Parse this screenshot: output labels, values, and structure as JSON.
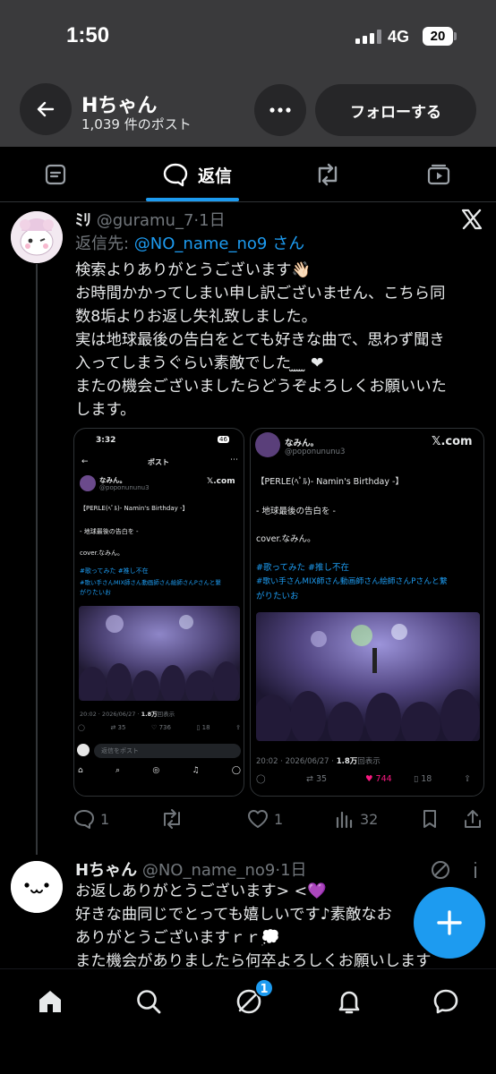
{
  "status_bar": {
    "time": "1:50",
    "network": "4G",
    "battery": "20"
  },
  "header": {
    "name": "Hちゃん",
    "post_count": "1,039 件のポスト",
    "follow_label": "フォローする"
  },
  "tabs": {
    "replies_label": "返信"
  },
  "post1": {
    "display_name": "ﾐﾘ",
    "handle": "@guramu_7",
    "time": "·1日",
    "reply_prefix": "返信先: ",
    "reply_handle": "@NO_name_no9",
    "reply_suffix": " さん",
    "lines": [
      "検索よりありがとうございます👋🏻",
      "お時間かかってしまい申し訳ございません、こちら同",
      "数8垢よりお返し失礼致しました。",
      "実は地球最後の告白をとても好きな曲で、思わず聞き",
      "入ってしまうぐらい素敵でした ̫ ̫ ̫ ❤",
      "またの機会ございましたらどうぞよろしくお願いいた",
      "します。"
    ],
    "stats": {
      "replies": "1",
      "likes": "1",
      "views": "32"
    }
  },
  "media1": {
    "time": "3:32",
    "battery": "46",
    "page_title": "ポスト",
    "author_name": "なみん。",
    "author_handle": "@poponununu3",
    "x_label": "𝕏.com",
    "line1": "【PERLE(ﾍﾟﾙ)- Namin's Birthday -】",
    "line2": "- 地球最後の告白を -",
    "line3": "cover.なみん。",
    "tags1": "#歌ってみた #推し不在",
    "tags2": "#歌い手さんMIX師さん動画師さん絵師さんPさんと繋",
    "tags3": "がりたいお",
    "meta_date": "20:02 · 2026/06/27 · ",
    "meta_views": "1.8万",
    "meta_suffix": "回表示",
    "retweets": "35",
    "likes": "736",
    "bookmarks": "18",
    "reply_placeholder": "返信をポスト"
  },
  "media2": {
    "author_name": "なみん。",
    "author_handle": "@poponununu3",
    "x_label": "𝕏.com",
    "line1": "【PERLE(ﾍﾟﾙ)- Namin's Birthday -】",
    "line2": "- 地球最後の告白を -",
    "line3": "cover.なみん。",
    "tags1": "#歌ってみた #推し不在",
    "tags2": "#歌い手さんMIX師さん動画師さん絵師さんPさんと繋",
    "tags3": "がりたいお",
    "meta_date": "20:02 · 2026/06/27 · ",
    "meta_views": "1.8万",
    "meta_suffix": "回表示",
    "retweets": "35",
    "likes": "744",
    "bookmarks": "18"
  },
  "post2": {
    "display_name": "Hちゃん",
    "handle": "@NO_name_no9",
    "time": "·1日",
    "lines": [
      "お返しありがとうございます> <💜",
      "好きな曲同じでとっても嬉しいです♪素敵なお",
      "ありがとうございますｒｒ💭",
      "また機会がありましたら何卒よろしくお願いします"
    ]
  },
  "nav": {
    "notification_badge": "1"
  },
  "colors": {
    "accent": "#1d9bf0",
    "like": "#f91880",
    "muted": "#71767b"
  }
}
